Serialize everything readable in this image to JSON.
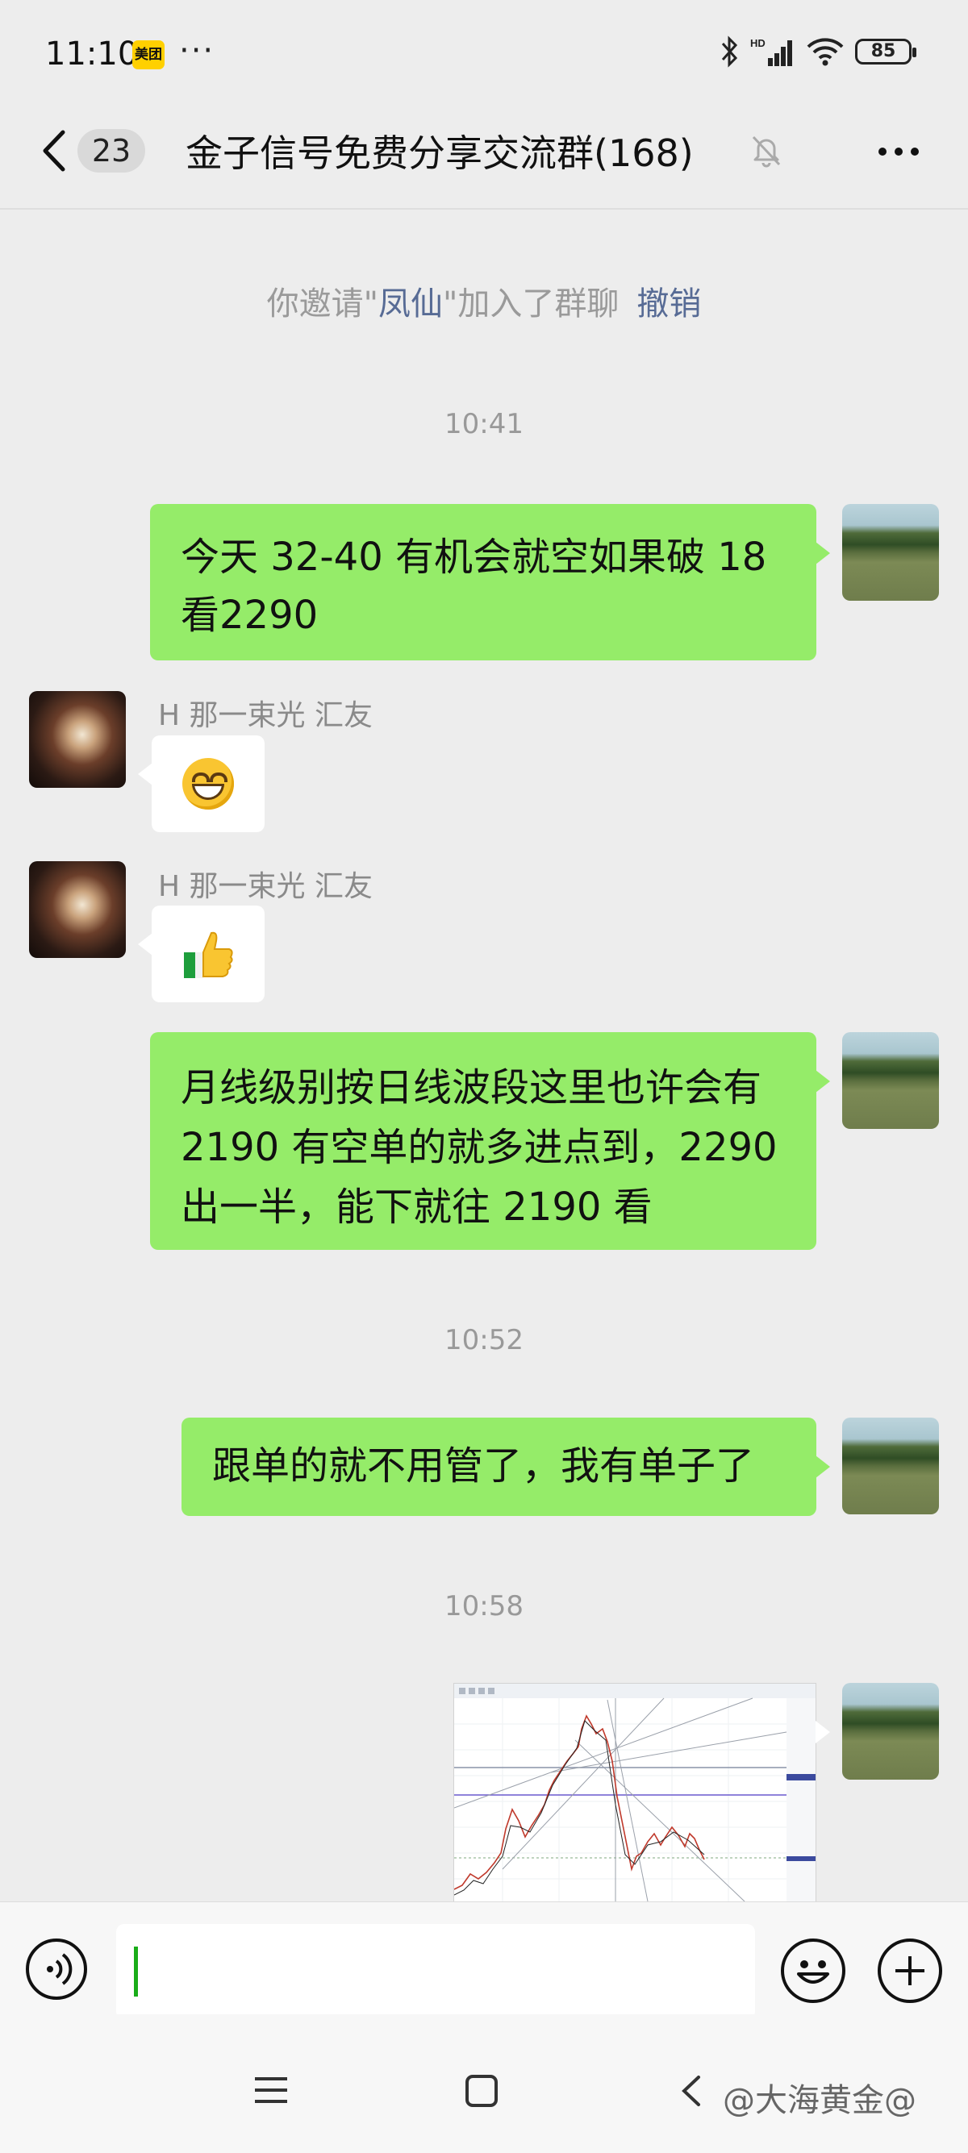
{
  "status_bar": {
    "time": "11:10",
    "app_badge": "美团",
    "dots": "···",
    "signal_tag": "HD",
    "battery": "85"
  },
  "header": {
    "unread": "23",
    "title": "金子信号免费分享交流群(168)"
  },
  "system_notice": {
    "prefix": "你邀请\"",
    "name": "凤仙",
    "suffix": "\"加入了群聊",
    "action": "撤销"
  },
  "timestamps": [
    "10:41",
    "10:52",
    "10:58"
  ],
  "messages": [
    {
      "line1": "今天 32-40 有机会就空如果破 18",
      "line2": "看2290"
    },
    {
      "sender": "H 那一束光 汇友"
    },
    {
      "sender": "H 那一束光 汇友"
    },
    {
      "line1": "月线级别按日线波段这里也许会有",
      "line2": "2190 有空单的就多进点到，2290",
      "line3": "出一半，能下就往 2190 看"
    },
    {
      "text": "跟单的就不用管了，我有单子了"
    }
  ],
  "watermark": "@大海黄金@",
  "colors": {
    "bubble_self": "#95ec69",
    "link": "#576b95",
    "background": "#ededed"
  },
  "icons": [
    "back-chevron-icon",
    "mute-bell-icon",
    "more-icon",
    "voice-icon",
    "emoji-icon",
    "plus-icon",
    "grin-emoji-icon",
    "thumbs-up-icon",
    "menu-icon",
    "home-icon",
    "back-icon"
  ]
}
